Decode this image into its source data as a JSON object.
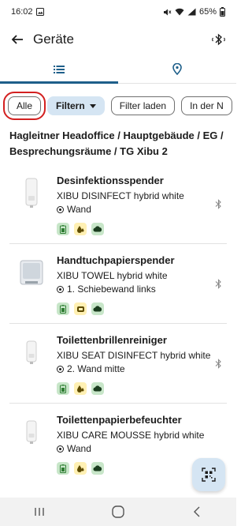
{
  "status_bar": {
    "time": "16:02",
    "battery": "65%"
  },
  "app_bar": {
    "title": "Geräte"
  },
  "tabs": [
    {
      "icon": "list-icon",
      "active": true
    },
    {
      "icon": "location-pin-icon",
      "active": false
    }
  ],
  "filters": {
    "all_label": "Alle",
    "filter_label": "Filtern",
    "load_label": "Filter laden",
    "near_label": "In der N"
  },
  "location_path": "Hagleitner Headoffice / Hauptgebäude / EG / Besprechungsräume / TG Xibu 2",
  "devices": [
    {
      "name": "Desinfektionsspender",
      "model": "XIBU DISINFECT hybrid white",
      "position": "Wand",
      "icons": [
        "battery-icon",
        "drop-icon",
        "cloud-icon"
      ]
    },
    {
      "name": "Handtuchpapierspender",
      "model": "XIBU TOWEL hybrid white",
      "position": "1. Schiebewand links",
      "icons": [
        "battery-icon",
        "paper-roll-icon",
        "cloud-icon"
      ]
    },
    {
      "name": "Toilettenbrillenreiniger",
      "model": "XIBU SEAT DISINFECT hybrid white",
      "position": "2. Wand mitte",
      "icons": [
        "battery-icon",
        "drop-icon",
        "cloud-icon"
      ]
    },
    {
      "name": "Toilettenpapierbefeuchter",
      "model": "XIBU CARE MOUSSE hybrid white",
      "position": "Wand",
      "icons": [
        "battery-icon",
        "drop-icon",
        "cloud-icon"
      ]
    }
  ],
  "colors": {
    "accent": "#1e5f8a",
    "chip_filled": "#d5e5f3",
    "status_green": "#c8e6c9",
    "status_yellow": "#fff0b3",
    "highlight": "#d32020"
  }
}
